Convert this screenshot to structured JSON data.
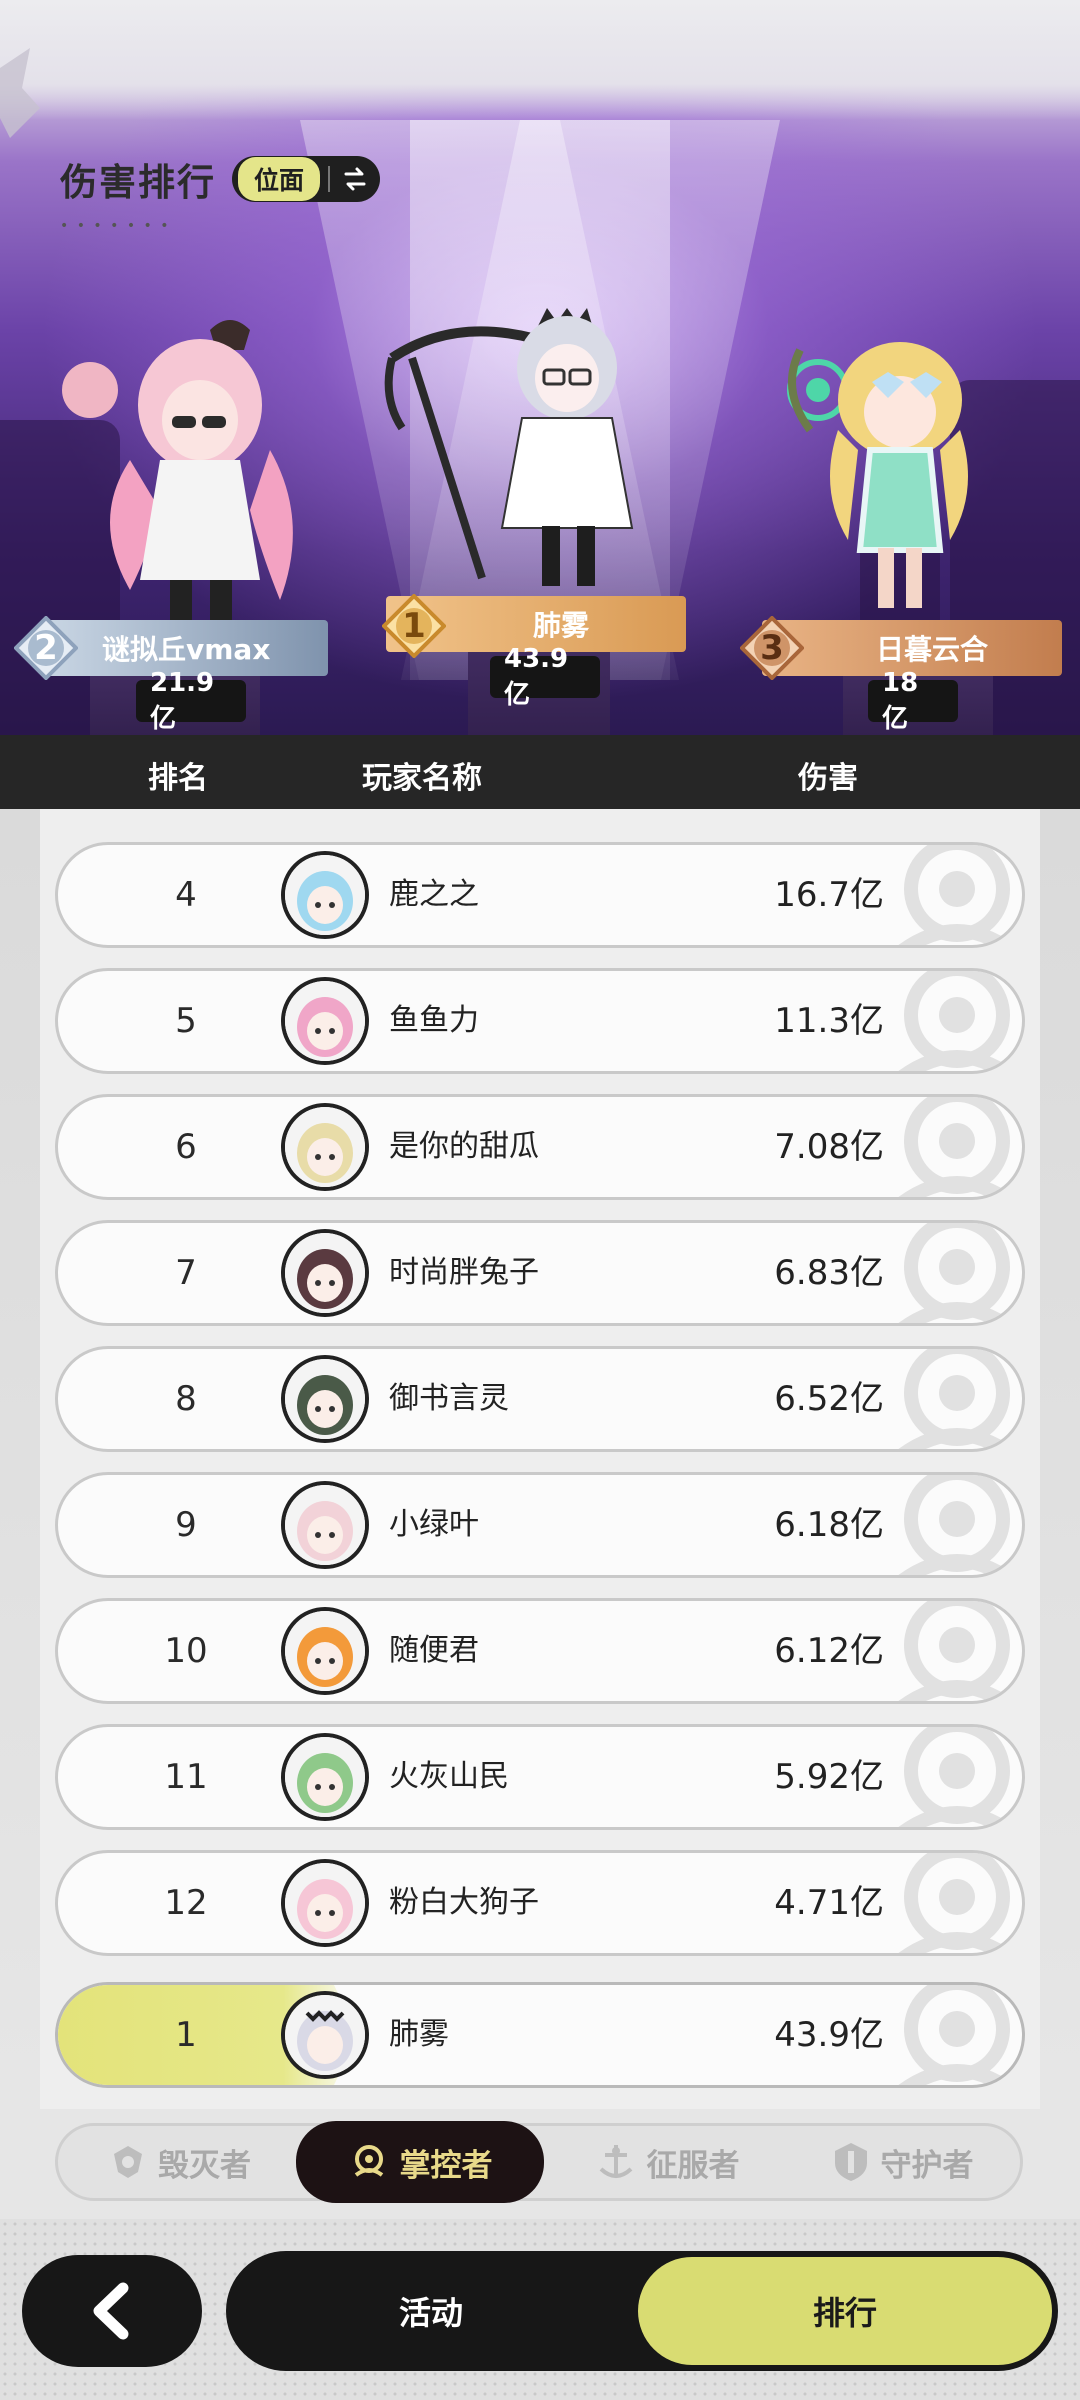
{
  "header": {
    "title": "伤害排行",
    "scope_label": "位面",
    "scope_toggle_icon": "swap-arrows-icon"
  },
  "podium": [
    {
      "rank": "1",
      "name": "肺雾",
      "value": "43.9亿",
      "medal": "gold"
    },
    {
      "rank": "2",
      "name": "谜拟丘vmax",
      "value": "21.9亿",
      "medal": "silver"
    },
    {
      "rank": "3",
      "name": "日暮云合",
      "value": "18亿",
      "medal": "bronze"
    }
  ],
  "table_header": {
    "rank": "排名",
    "player_name": "玩家名称",
    "damage": "伤害"
  },
  "rows": [
    {
      "rank": "4",
      "name": "鹿之之",
      "damage": "16.7亿",
      "avatar_color": "#9fd8f0"
    },
    {
      "rank": "5",
      "name": "鱼鱼力",
      "damage": "11.3亿",
      "avatar_color": "#f0a6c8"
    },
    {
      "rank": "6",
      "name": "是你的甜瓜",
      "damage": "7.08亿",
      "avatar_color": "#e8dca8"
    },
    {
      "rank": "7",
      "name": "时尚胖兔子",
      "damage": "6.83亿",
      "avatar_color": "#5a3a40"
    },
    {
      "rank": "8",
      "name": "御书言灵",
      "damage": "6.52亿",
      "avatar_color": "#4a5a48"
    },
    {
      "rank": "9",
      "name": "小绿叶",
      "damage": "6.18亿",
      "avatar_color": "#f2d2d8"
    },
    {
      "rank": "10",
      "name": "随便君",
      "damage": "6.12亿",
      "avatar_color": "#f39a3a"
    },
    {
      "rank": "11",
      "name": "火灰山民",
      "damage": "5.92亿",
      "avatar_color": "#8fc98a"
    },
    {
      "rank": "12",
      "name": "粉白大狗子",
      "damage": "4.71亿",
      "avatar_color": "#f6c6d6"
    }
  ],
  "self_row": {
    "rank": "1",
    "name": "肺雾",
    "damage": "43.9亿",
    "avatar_color": "#d9d9e6"
  },
  "tabs": [
    {
      "label": "毁灭者",
      "icon": "destroyer-emblem-icon",
      "active": false
    },
    {
      "label": "掌控者",
      "icon": "controller-emblem-icon",
      "active": true
    },
    {
      "label": "征服者",
      "icon": "conqueror-emblem-icon",
      "active": false
    },
    {
      "label": "守护者",
      "icon": "guardian-emblem-icon",
      "active": false
    }
  ],
  "bottom_nav": {
    "back_icon": "chevron-left-icon",
    "activity": "活动",
    "ranking": "排行"
  },
  "colors": {
    "accent_yellow": "#d9dc72",
    "dark": "#171717",
    "gold": "#e2a85f",
    "silver": "#8fa3bc",
    "bronze": "#c98656"
  }
}
